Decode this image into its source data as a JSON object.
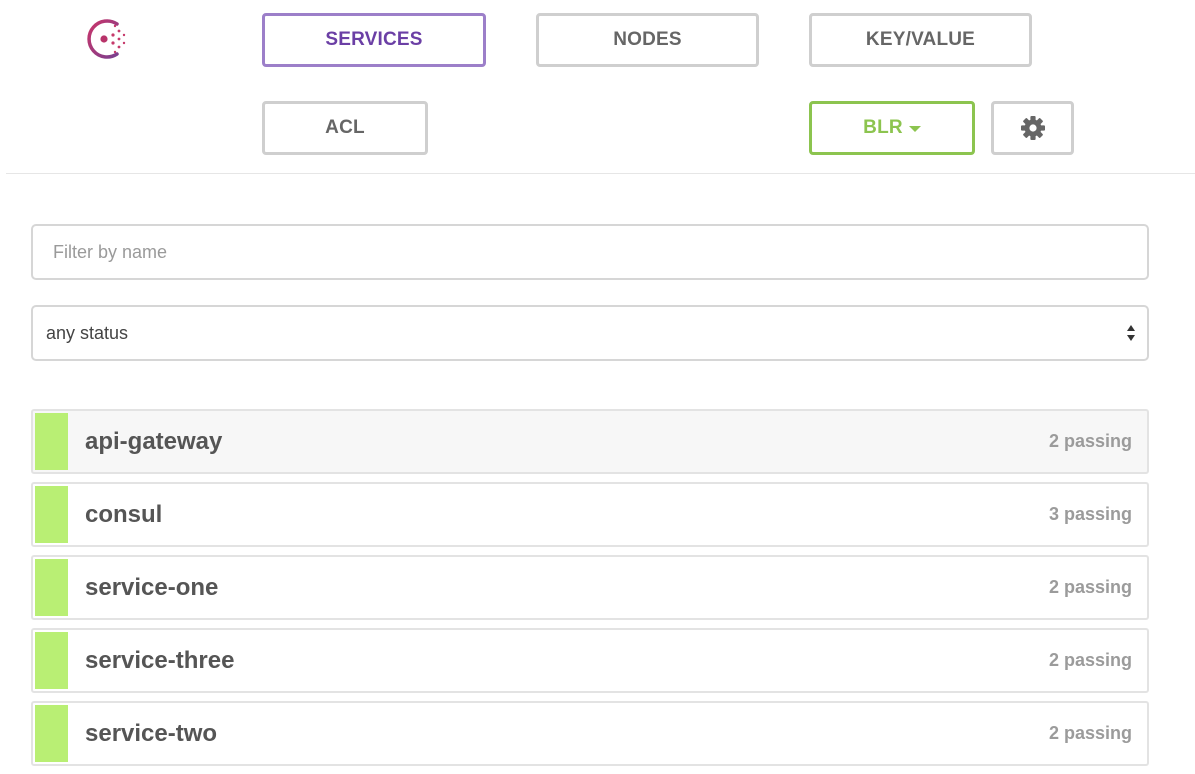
{
  "nav": {
    "services": "SERVICES",
    "nodes": "NODES",
    "key_value": "KEY/VALUE",
    "acl": "ACL",
    "datacenter": "BLR"
  },
  "filter": {
    "placeholder": "Filter by name",
    "value": ""
  },
  "status_select": {
    "selected": "any status"
  },
  "services": [
    {
      "name": "api-gateway",
      "checks": "2 passing"
    },
    {
      "name": "consul",
      "checks": "3 passing"
    },
    {
      "name": "service-one",
      "checks": "2 passing"
    },
    {
      "name": "service-three",
      "checks": "2 passing"
    },
    {
      "name": "service-two",
      "checks": "2 passing"
    }
  ],
  "colors": {
    "brand_purple": "#9c7fc9",
    "logo_magenta": "#c63a6b",
    "datacenter_green": "#8cc44f",
    "passing_green": "#b9ef74"
  },
  "icons": {
    "logo": "consul-logo-icon",
    "settings": "gear-icon",
    "dropdown": "caret-down-icon",
    "select": "select-arrows-icon"
  }
}
